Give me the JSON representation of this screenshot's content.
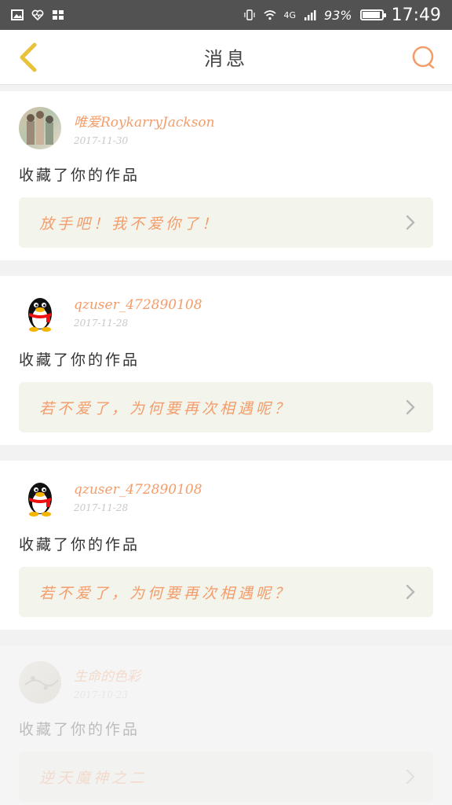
{
  "status_bar": {
    "network": "4G",
    "battery": "93%",
    "time": "17:49"
  },
  "header": {
    "title": "消息",
    "back_icon": "chevron-left-icon",
    "search_icon": "search-icon",
    "accent_color": "#f39d6b",
    "back_color": "#e8c23a"
  },
  "messages": [
    {
      "username": "唯爱RoykarryJackson",
      "date": "2017-11-30",
      "action": "收藏了你的作品",
      "work_title": "放手吧！我不爱你了！",
      "avatar_icon": "photo-avatar"
    },
    {
      "username": "qzuser_472890108",
      "date": "2017-11-28",
      "action": "收藏了你的作品",
      "work_title": "若不爱了，为何要再次相遇呢？",
      "avatar_icon": "penguin-avatar"
    },
    {
      "username": "qzuser_472890108",
      "date": "2017-11-28",
      "action": "收藏了你的作品",
      "work_title": "若不爱了，为何要再次相遇呢？",
      "avatar_icon": "penguin-avatar"
    },
    {
      "username": "生命的色彩",
      "date": "2017-10-23",
      "action": "收藏了你的作品",
      "work_title": "逆天魔神之二",
      "avatar_icon": "photo-avatar"
    }
  ]
}
